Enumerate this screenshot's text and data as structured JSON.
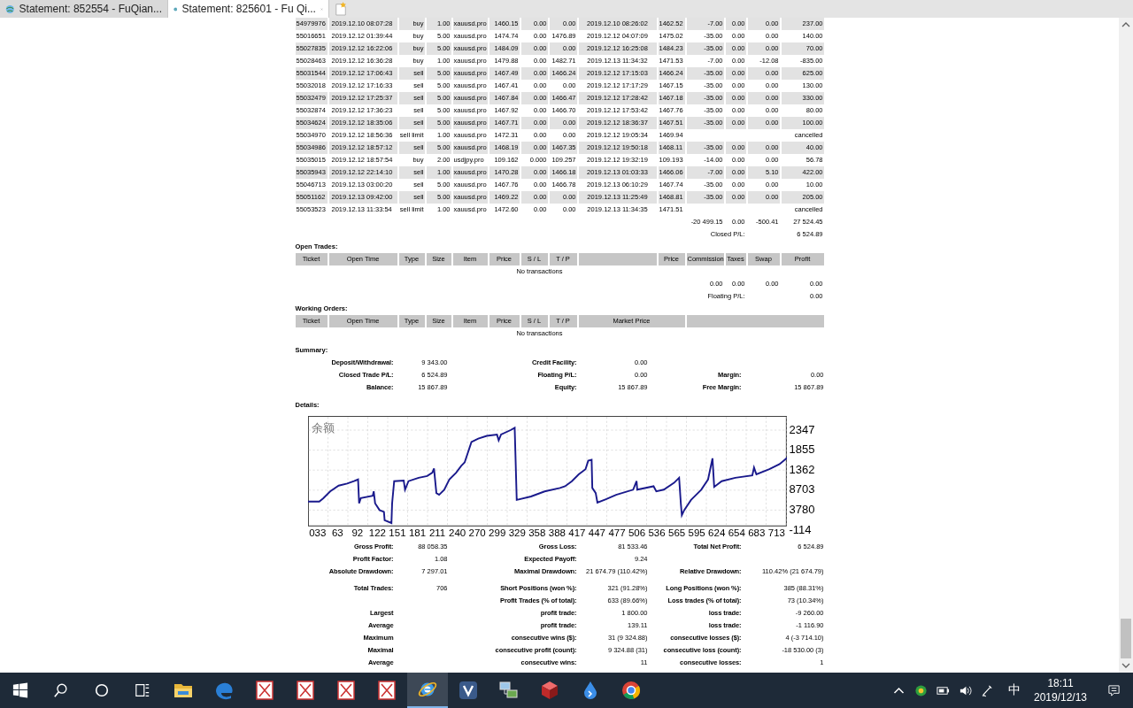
{
  "browser_tabs": [
    {
      "title": "Statement: 852554 - FuQian...",
      "selected": false
    },
    {
      "title": "Statement: 825601 - Fu Qi...",
      "selected": true
    }
  ],
  "closed_trades": {
    "rows": [
      {
        "ticket": "54979976",
        "open_time": "2019.12.10 08:07:28",
        "type": "buy",
        "size": "1.00",
        "item": "xauusd.pro",
        "price": "1460.15",
        "sl": "0.00",
        "tp": "0.00",
        "close_time": "2019.12.10 08:26:02",
        "close_price": "1462.52",
        "commission": "-7.00",
        "taxes": "0.00",
        "swap": "0.00",
        "profit": "237.00"
      },
      {
        "ticket": "55016651",
        "open_time": "2019.12.12 01:39:44",
        "type": "buy",
        "size": "5.00",
        "item": "xauusd.pro",
        "price": "1474.74",
        "sl": "0.00",
        "tp": "1476.89",
        "close_time": "2019.12.12 04:07:09",
        "close_price": "1475.02",
        "commission": "-35.00",
        "taxes": "0.00",
        "swap": "0.00",
        "profit": "140.00"
      },
      {
        "ticket": "55027835",
        "open_time": "2019.12.12 16:22:06",
        "type": "buy",
        "size": "5.00",
        "item": "xauusd.pro",
        "price": "1484.09",
        "sl": "0.00",
        "tp": "0.00",
        "close_time": "2019.12.12 16:25:08",
        "close_price": "1484.23",
        "commission": "-35.00",
        "taxes": "0.00",
        "swap": "0.00",
        "profit": "70.00"
      },
      {
        "ticket": "55028463",
        "open_time": "2019.12.12 16:36:28",
        "type": "buy",
        "size": "1.00",
        "item": "xauusd.pro",
        "price": "1479.88",
        "sl": "0.00",
        "tp": "1482.71",
        "close_time": "2019.12.13 11:34:32",
        "close_price": "1471.53",
        "commission": "-7.00",
        "taxes": "0.00",
        "swap": "-12.08",
        "profit": "-835.00"
      },
      {
        "ticket": "55031544",
        "open_time": "2019.12.12 17:06:43",
        "type": "sell",
        "size": "5.00",
        "item": "xauusd.pro",
        "price": "1467.49",
        "sl": "0.00",
        "tp": "1466.24",
        "close_time": "2019.12.12 17:15:03",
        "close_price": "1466.24",
        "commission": "-35.00",
        "taxes": "0.00",
        "swap": "0.00",
        "profit": "625.00"
      },
      {
        "ticket": "55032018",
        "open_time": "2019.12.12 17:16:33",
        "type": "sell",
        "size": "5.00",
        "item": "xauusd.pro",
        "price": "1467.41",
        "sl": "0.00",
        "tp": "0.00",
        "close_time": "2019.12.12 17:17:29",
        "close_price": "1467.15",
        "commission": "-35.00",
        "taxes": "0.00",
        "swap": "0.00",
        "profit": "130.00"
      },
      {
        "ticket": "55032479",
        "open_time": "2019.12.12 17:25:37",
        "type": "sell",
        "size": "5.00",
        "item": "xauusd.pro",
        "price": "1467.84",
        "sl": "0.00",
        "tp": "1466.47",
        "close_time": "2019.12.12 17:28:42",
        "close_price": "1467.18",
        "commission": "-35.00",
        "taxes": "0.00",
        "swap": "0.00",
        "profit": "330.00"
      },
      {
        "ticket": "55032874",
        "open_time": "2019.12.12 17:36:23",
        "type": "sell",
        "size": "5.00",
        "item": "xauusd.pro",
        "price": "1467.92",
        "sl": "0.00",
        "tp": "1466.70",
        "close_time": "2019.12.12 17:53:42",
        "close_price": "1467.76",
        "commission": "-35.00",
        "taxes": "0.00",
        "swap": "0.00",
        "profit": "80.00"
      },
      {
        "ticket": "55034624",
        "open_time": "2019.12.12 18:35:06",
        "type": "sell",
        "size": "5.00",
        "item": "xauusd.pro",
        "price": "1467.71",
        "sl": "0.00",
        "tp": "0.00",
        "close_time": "2019.12.12 18:36:37",
        "close_price": "1467.51",
        "commission": "-35.00",
        "taxes": "0.00",
        "swap": "0.00",
        "profit": "100.00"
      },
      {
        "ticket": "55034970",
        "open_time": "2019.12.12 18:56:36",
        "type": "sell limit",
        "size": "1.00",
        "item": "xauusd.pro",
        "price": "1472.31",
        "sl": "0.00",
        "tp": "0.00",
        "close_time": "2019.12.12 19:05:34",
        "close_price": "1469.94",
        "profit": "cancelled"
      },
      {
        "ticket": "55034986",
        "open_time": "2019.12.12 18:57:12",
        "type": "sell",
        "size": "5.00",
        "item": "xauusd.pro",
        "price": "1468.19",
        "sl": "0.00",
        "tp": "1467.35",
        "close_time": "2019.12.12 19:50:18",
        "close_price": "1468.11",
        "commission": "-35.00",
        "taxes": "0.00",
        "swap": "0.00",
        "profit": "40.00"
      },
      {
        "ticket": "55035015",
        "open_time": "2019.12.12 18:57:54",
        "type": "buy",
        "size": "2.00",
        "item": "usdjpy.pro",
        "price": "109.162",
        "sl": "0.000",
        "tp": "109.257",
        "close_time": "2019.12.12 19:32:19",
        "close_price": "109.193",
        "commission": "-14.00",
        "taxes": "0.00",
        "swap": "0.00",
        "profit": "56.78"
      },
      {
        "ticket": "55035943",
        "open_time": "2019.12.12 22:14:10",
        "type": "sell",
        "size": "1.00",
        "item": "xauusd.pro",
        "price": "1470.28",
        "sl": "0.00",
        "tp": "1466.18",
        "close_time": "2019.12.13 01:03:33",
        "close_price": "1466.06",
        "commission": "-7.00",
        "taxes": "0.00",
        "swap": "5.10",
        "profit": "422.00"
      },
      {
        "ticket": "55046713",
        "open_time": "2019.12.13 03:00:20",
        "type": "sell",
        "size": "5.00",
        "item": "xauusd.pro",
        "price": "1467.76",
        "sl": "0.00",
        "tp": "1466.78",
        "close_time": "2019.12.13 06:10:29",
        "close_price": "1467.74",
        "commission": "-35.00",
        "taxes": "0.00",
        "swap": "0.00",
        "profit": "10.00"
      },
      {
        "ticket": "55051162",
        "open_time": "2019.12.13 09:42:00",
        "type": "sell",
        "size": "5.00",
        "item": "xauusd.pro",
        "price": "1469.22",
        "sl": "0.00",
        "tp": "0.00",
        "close_time": "2019.12.13 11:25:49",
        "close_price": "1468.81",
        "commission": "-35.00",
        "taxes": "0.00",
        "swap": "0.00",
        "profit": "205.00"
      },
      {
        "ticket": "55053523",
        "open_time": "2019.12.13 11:33:54",
        "type": "sell limit",
        "size": "1.00",
        "item": "xauusd.pro",
        "price": "1472.60",
        "sl": "0.00",
        "tp": "0.00",
        "close_time": "2019.12.13 11:34:35",
        "close_price": "1471.51",
        "profit": "cancelled"
      }
    ],
    "totals": {
      "commission": "-20 499.15",
      "taxes": "0.00",
      "swap": "-500.41",
      "profit": "27 524.45"
    },
    "pl_label": "Closed P/L:",
    "pl": "6 524.89"
  },
  "open_trades": {
    "title": "Open Trades:",
    "columns_left": [
      "Ticket",
      "Open Time",
      "Type",
      "Size",
      "Item",
      "Price",
      "S / L",
      "T / P"
    ],
    "columns_right": [
      "Price",
      "Commission",
      "Taxes",
      "Swap",
      "Profit"
    ],
    "empty": "No transactions",
    "totals": {
      "commission": "0.00",
      "taxes": "0.00",
      "swap": "0.00",
      "profit": "0.00"
    },
    "pl_label": "Floating P/L:",
    "pl": "0.00"
  },
  "working_orders": {
    "title": "Working Orders:",
    "columns_left": [
      "Ticket",
      "Open Time",
      "Type",
      "Size",
      "Item",
      "Price",
      "S / L",
      "T / P"
    ],
    "market_price": "Market Price",
    "empty": "No transactions"
  },
  "summary": {
    "title": "Summary:",
    "rows": [
      {
        "left": {
          "label": "Deposit/Withdrawal:",
          "value": "9 343.00"
        },
        "middle": {
          "label": "Credit Facility:",
          "value": "0.00"
        }
      },
      {
        "left": {
          "label": "Closed Trade P/L:",
          "value": "6 524.89"
        },
        "middle": {
          "label": "Floating P/L:",
          "value": "0.00"
        },
        "right": {
          "label": "Margin:",
          "value": "0.00"
        }
      },
      {
        "left": {
          "label": "Balance:",
          "value": "15 867.89"
        },
        "middle": {
          "label": "Equity:",
          "value": "15 867.89"
        },
        "right": {
          "label": "Free Margin:",
          "value": "15 867.89"
        }
      }
    ]
  },
  "details": {
    "title": "Details:",
    "chart": {
      "title": "余额",
      "y_labels": [
        "2347",
        "1855",
        "1362",
        "8703",
        "3780",
        "-114"
      ],
      "x_labels": [
        "033",
        "63",
        "92",
        "122",
        "151",
        "181",
        "211",
        "240",
        "270",
        "299",
        "329",
        "358",
        "388",
        "417",
        "447",
        "477",
        "506",
        "536",
        "565",
        "595",
        "624",
        "654",
        "683",
        "713"
      ]
    },
    "blocks": [
      [
        {
          "left": {
            "label": "Gross Profit:",
            "value": "88 058.35"
          },
          "middle": {
            "label": "Gross Loss:",
            "value": "81 533.46"
          },
          "right": {
            "label": "Total Net Profit:",
            "value": "6 524.89"
          }
        },
        {
          "left": {
            "label": "Profit Factor:",
            "value": "1.08"
          },
          "middle": {
            "label": "Expected Payoff:",
            "value": "9.24"
          }
        },
        {
          "left": {
            "label": "Absolute Drawdown:",
            "value": "7 297.01"
          },
          "middle": {
            "label": "Maximal Drawdown:",
            "value": "21 674.79 (110.42%)"
          },
          "right": {
            "label": "Relative Drawdown:",
            "value": "110.42% (21 674.79)"
          }
        }
      ],
      [
        {
          "left": {
            "label": "Total Trades:",
            "value": "706"
          },
          "middle": {
            "label": "Short Positions (won %):",
            "value": "321 (91.28%)"
          },
          "right": {
            "label": "Long Positions (won %):",
            "value": "385 (88.31%)"
          }
        },
        {
          "middle": {
            "label": "Profit Trades (% of total):",
            "value": "633 (89.66%)"
          },
          "right": {
            "label": "Loss trades (% of total):",
            "value": "73 (10.34%)"
          }
        },
        {
          "left": {
            "label": "Largest"
          },
          "middle": {
            "label": "profit trade:",
            "value": "1 800.00"
          },
          "right": {
            "label": "loss trade:",
            "value": "-9 260.00"
          }
        },
        {
          "left": {
            "label": "Average"
          },
          "middle": {
            "label": "profit trade:",
            "value": "139.11"
          },
          "right": {
            "label": "loss trade:",
            "value": "-1 116.90"
          }
        },
        {
          "left": {
            "label": "Maximum"
          },
          "middle": {
            "label": "consecutive wins ($):",
            "value": "31 (9 324.88)"
          },
          "right": {
            "label": "consecutive losses ($):",
            "value": "4 (-3 714.10)"
          }
        },
        {
          "left": {
            "label": "Maximal"
          },
          "middle": {
            "label": "consecutive profit (count):",
            "value": "9 324.88 (31)"
          },
          "right": {
            "label": "consecutive loss (count):",
            "value": "-18 530.00 (3)"
          }
        },
        {
          "left": {
            "label": "Average"
          },
          "middle": {
            "label": "consecutive wins:",
            "value": "11"
          },
          "right": {
            "label": "consecutive losses:",
            "value": "1"
          }
        }
      ]
    ]
  },
  "taskbar": {
    "apps": [
      {
        "kind": "folder",
        "selected": false
      },
      {
        "kind": "edge",
        "selected": false
      },
      {
        "kind": "doc",
        "selected": false
      },
      {
        "kind": "doc",
        "selected": false
      },
      {
        "kind": "doc",
        "selected": false
      },
      {
        "kind": "doc",
        "selected": false
      },
      {
        "kind": "ie",
        "selected": true
      },
      {
        "kind": "tile",
        "selected": false
      },
      {
        "kind": "network",
        "selected": false
      },
      {
        "kind": "cube",
        "selected": false
      },
      {
        "kind": "drop",
        "selected": false
      },
      {
        "kind": "circle",
        "selected": false
      }
    ],
    "ime": "中",
    "time": "18:11",
    "date": "2019/12/13"
  }
}
